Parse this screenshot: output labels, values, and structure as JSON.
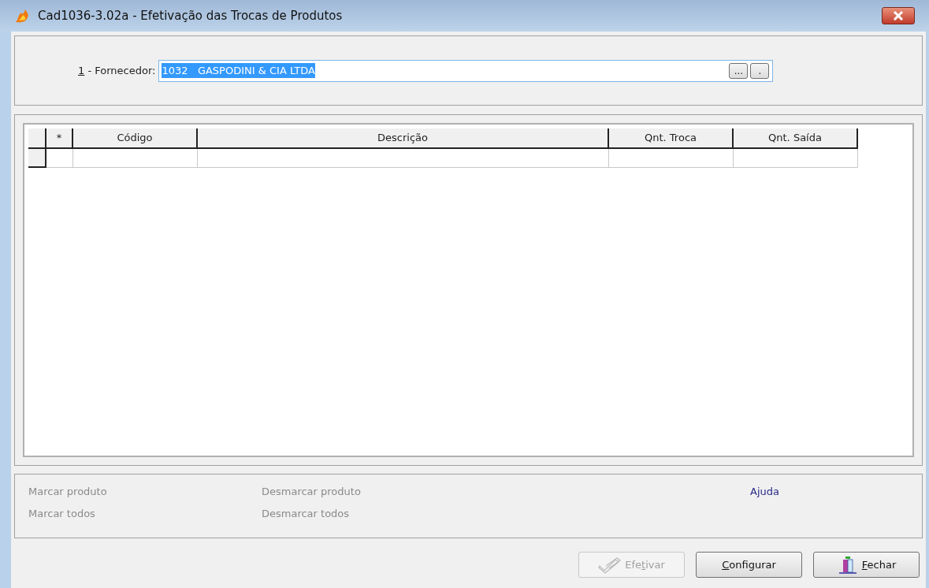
{
  "window": {
    "title": "Cad1036-3.02a - Efetivação das Trocas de Produtos"
  },
  "fornecedor": {
    "label_parts": {
      "key": "1",
      "after": " - Fornecedor:"
    },
    "value": "1032   GASPODINI & CIA LTDA",
    "value_selected": true,
    "lookup_buttons": [
      "...",
      "."
    ]
  },
  "grid": {
    "columns": [
      "*",
      "Código",
      "Descrição",
      "Qnt. Troca",
      "Qnt. Saída"
    ]
  },
  "actions": [
    {
      "label": "Marcar produto",
      "disabled": true
    },
    {
      "label": "Marcar todos",
      "disabled": true
    },
    {
      "label": "Desmarcar produto",
      "disabled": true
    },
    {
      "label": "Desmarcar todos",
      "disabled": true
    },
    {
      "label": "Ajuda",
      "disabled": false
    }
  ],
  "buttons": [
    {
      "kind": "check",
      "label_parts": {
        "before": "Efe",
        "key": "t",
        "after": "ivar"
      },
      "disabled": true
    },
    {
      "kind": "plain",
      "label_parts": {
        "key": "C",
        "after": "onfigurar"
      },
      "disabled": false
    },
    {
      "kind": "exit",
      "label_parts": {
        "key": "F",
        "after": "echar"
      },
      "disabled": false
    }
  ]
}
